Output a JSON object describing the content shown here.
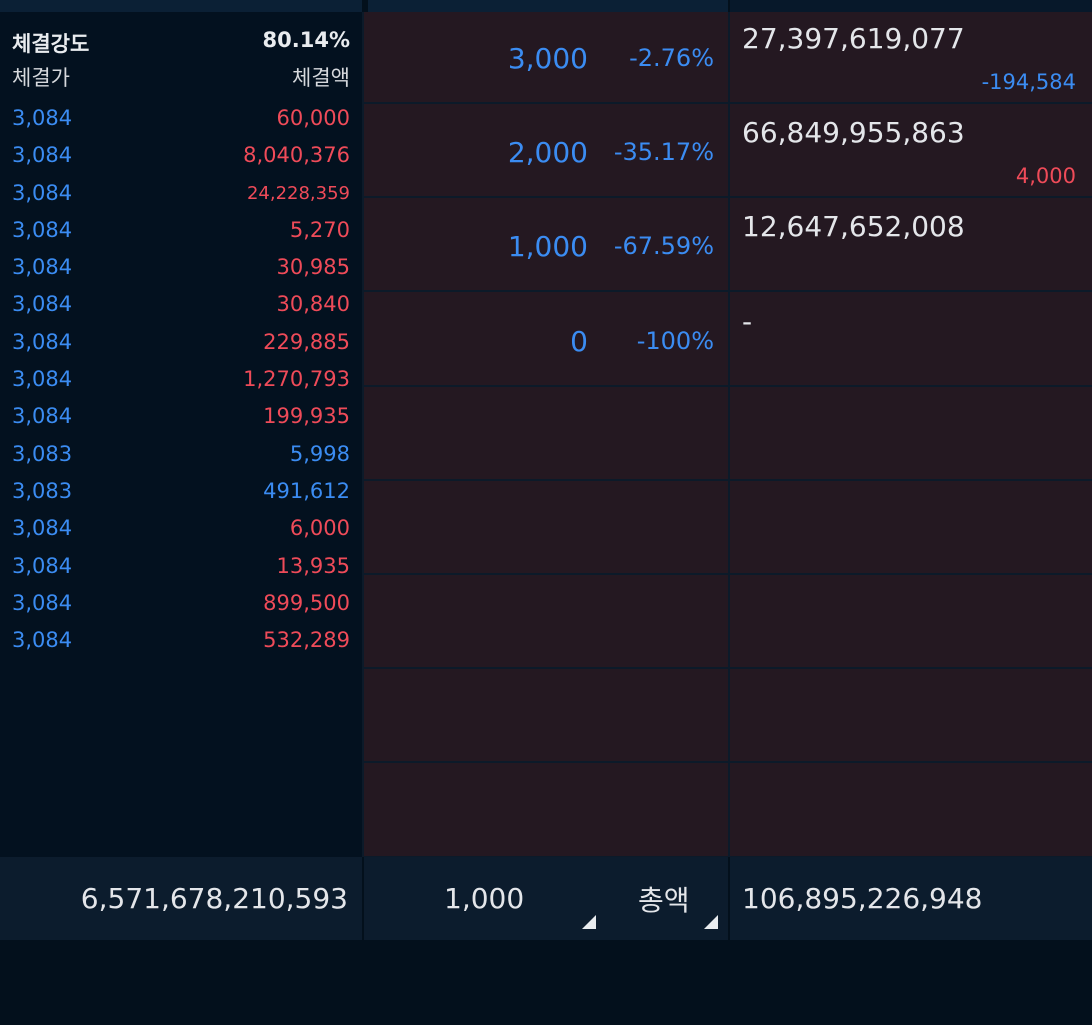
{
  "colors": {
    "up": "#ef4b59",
    "down": "#3b8cf2",
    "text": "#e4e6ea",
    "ladder_bg": "#241821",
    "panel_bg": "#03111f",
    "summary_bg": "#0c1c2d"
  },
  "strength": {
    "label": "체결강도",
    "value": "80.14%"
  },
  "trade_headers": {
    "price": "체결가",
    "amount": "체결액"
  },
  "trades": [
    {
      "price": "3,084",
      "amount": "60,000",
      "dir": "up"
    },
    {
      "price": "3,084",
      "amount": "8,040,376",
      "dir": "up"
    },
    {
      "price": "3,084",
      "amount": "24,228,359",
      "dir": "up",
      "small": true
    },
    {
      "price": "3,084",
      "amount": "5,270",
      "dir": "up"
    },
    {
      "price": "3,084",
      "amount": "30,985",
      "dir": "up"
    },
    {
      "price": "3,084",
      "amount": "30,840",
      "dir": "up"
    },
    {
      "price": "3,084",
      "amount": "229,885",
      "dir": "up"
    },
    {
      "price": "3,084",
      "amount": "1,270,793",
      "dir": "up"
    },
    {
      "price": "3,084",
      "amount": "199,935",
      "dir": "up"
    },
    {
      "price": "3,083",
      "amount": "5,998",
      "dir": "down"
    },
    {
      "price": "3,083",
      "amount": "491,612",
      "dir": "down"
    },
    {
      "price": "3,084",
      "amount": "6,000",
      "dir": "up"
    },
    {
      "price": "3,084",
      "amount": "13,935",
      "dir": "up"
    },
    {
      "price": "3,084",
      "amount": "899,500",
      "dir": "up"
    },
    {
      "price": "3,084",
      "amount": "532,289",
      "dir": "up"
    }
  ],
  "ladder": [
    {
      "price": "3,000",
      "pct": "-2.76%"
    },
    {
      "price": "2,000",
      "pct": "-35.17%"
    },
    {
      "price": "1,000",
      "pct": "-67.59%"
    },
    {
      "price": "0",
      "pct": "-100%"
    },
    {
      "price": "",
      "pct": ""
    },
    {
      "price": "",
      "pct": ""
    },
    {
      "price": "",
      "pct": ""
    },
    {
      "price": "",
      "pct": ""
    },
    {
      "price": "",
      "pct": ""
    }
  ],
  "volumes": [
    {
      "main": "27,397,619,077",
      "change": "-194,584",
      "dir": "down"
    },
    {
      "main": "66,849,955,863",
      "change": "4,000",
      "dir": "up"
    },
    {
      "main": "12,647,652,008",
      "change": "",
      "dir": ""
    },
    {
      "main": "-",
      "change": "",
      "dir": ""
    },
    {
      "main": "",
      "change": "",
      "dir": ""
    },
    {
      "main": "",
      "change": "",
      "dir": ""
    },
    {
      "main": "",
      "change": "",
      "dir": ""
    },
    {
      "main": "",
      "change": "",
      "dir": ""
    },
    {
      "main": "",
      "change": "",
      "dir": ""
    }
  ],
  "summary": {
    "total_trade_amount": "6,571,678,210,593",
    "unit_selector": "1,000",
    "type_selector": "총액",
    "total_volume": "106,895,226,948"
  }
}
